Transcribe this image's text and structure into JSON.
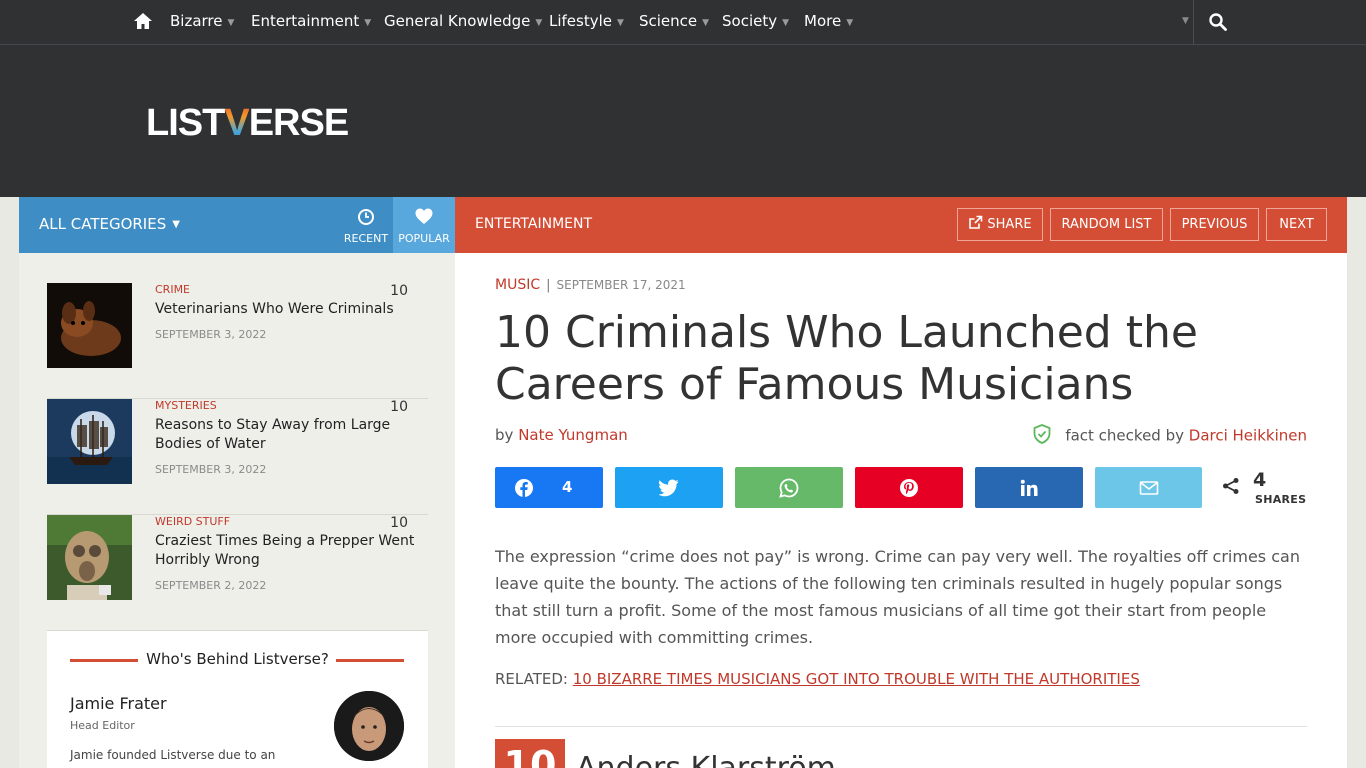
{
  "nav": {
    "items": [
      {
        "label": "Bizarre"
      },
      {
        "label": "Entertainment"
      },
      {
        "label": "General Knowledge"
      },
      {
        "label": "Lifestyle"
      },
      {
        "label": "Science"
      },
      {
        "label": "Society"
      },
      {
        "label": "More"
      }
    ]
  },
  "logo": {
    "part1": "LIST",
    "part2": "V",
    "part3": "ERSE"
  },
  "catbar": {
    "all_categories": "ALL CATEGORIES",
    "recent": "RECENT",
    "popular": "POPULAR",
    "current_category": "ENTERTAINMENT",
    "share": "SHARE",
    "random": "RANDOM LIST",
    "previous": "PREVIOUS",
    "next": "NEXT"
  },
  "sidebar": {
    "items": [
      {
        "category": "CRIME",
        "count": "10",
        "title": "Veterinarians Who Were Criminals",
        "date": "SEPTEMBER 3, 2022"
      },
      {
        "category": "MYSTERIES",
        "count": "10",
        "title": "Reasons to Stay Away from Large Bodies of Water",
        "date": "SEPTEMBER 3, 2022"
      },
      {
        "category": "WEIRD STUFF",
        "count": "10",
        "title": "Craziest Times Being a Prepper Went Horribly Wrong",
        "date": "SEPTEMBER 2, 2022"
      }
    ],
    "who": {
      "title": "Who's Behind Listverse?",
      "name": "Jamie Frater",
      "role": "Head Editor",
      "desc": "Jamie founded Listverse due to an"
    }
  },
  "article": {
    "category": "MUSIC",
    "date": "SEPTEMBER 17, 2021",
    "title": "10 Criminals Who Launched the Careers of Famous Musicians",
    "by": "by",
    "author": "Nate Yungman",
    "fact_checked_by": "fact checked by",
    "fact_checker": "Darci Heikkinen",
    "shares": {
      "facebook_count": "4",
      "total": "4",
      "label": "SHARES"
    },
    "intro": "The expression “crime does not pay” is wrong. Crime can pay very well. The royalties off crimes can leave quite the bounty. The actions of the following ten criminals resulted in hugely popular songs that still turn a profit. Some of the most famous musicians of all time got their start from people more occupied with committing crimes.",
    "related_label": "RELATED:",
    "related_link": "10 BIZARRE TIMES MUSICIANS GOT INTO TROUBLE WITH THE AUTHORITIES",
    "entry_number": "10",
    "entry_title": "Anders Klarström"
  },
  "colors": {
    "nav_bg": "#2f3133",
    "blue": "#3e8ec5",
    "red": "#d34e35",
    "facebook": "#1877f2",
    "twitter": "#1da1f2",
    "whatsapp": "#65b968",
    "pinterest": "#e60023",
    "linkedin": "#2867b2",
    "email": "#6cc6e8"
  }
}
